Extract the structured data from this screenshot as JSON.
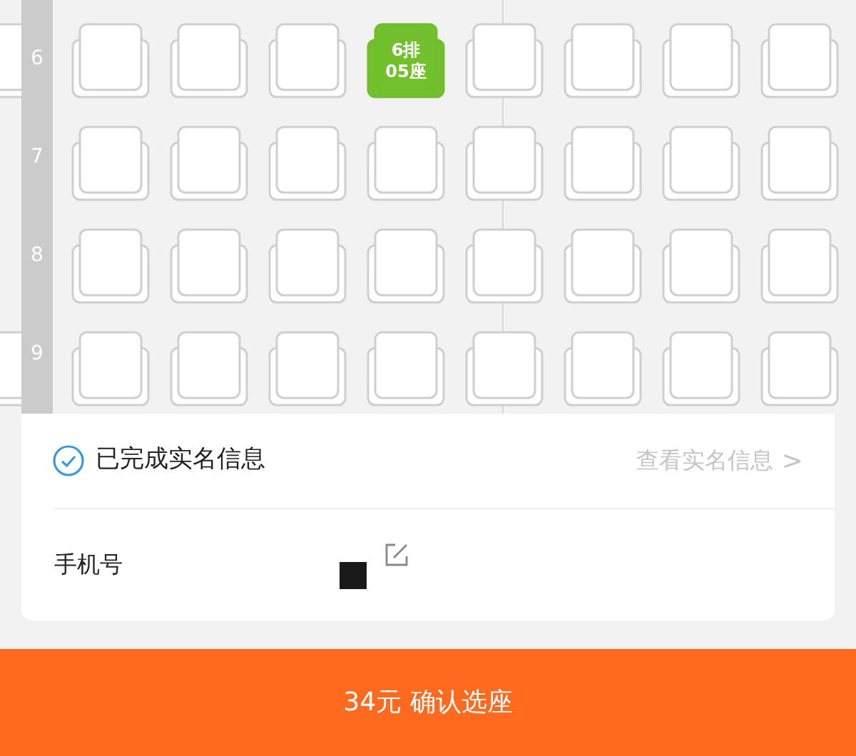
{
  "seat_map": {
    "rows": [
      {
        "label": "6",
        "edge_seat": true,
        "seats": [
          {
            "selected": false
          },
          {
            "selected": false
          },
          {
            "selected": false
          },
          {
            "selected": true,
            "lines": [
              "6排",
              "05座"
            ]
          },
          {
            "selected": false
          },
          {
            "selected": false
          },
          {
            "selected": false
          },
          {
            "selected": false
          }
        ]
      },
      {
        "label": "7",
        "edge_seat": false,
        "seats": [
          {
            "selected": false
          },
          {
            "selected": false
          },
          {
            "selected": false
          },
          {
            "selected": false
          },
          {
            "selected": false
          },
          {
            "selected": false
          },
          {
            "selected": false
          },
          {
            "selected": false
          }
        ]
      },
      {
        "label": "8",
        "edge_seat": false,
        "seats": [
          {
            "selected": false
          },
          {
            "selected": false
          },
          {
            "selected": false
          },
          {
            "selected": false
          },
          {
            "selected": false
          },
          {
            "selected": false
          },
          {
            "selected": false
          },
          {
            "selected": false
          }
        ]
      },
      {
        "label": "9",
        "edge_seat": true,
        "seats": [
          {
            "selected": false
          },
          {
            "selected": false
          },
          {
            "selected": false
          },
          {
            "selected": false
          },
          {
            "selected": false
          },
          {
            "selected": false
          },
          {
            "selected": false
          },
          {
            "selected": false
          }
        ]
      }
    ]
  },
  "real_name": {
    "verified": true,
    "status": "已完成实名信息",
    "link": "查看实名信息",
    "arrow": ">"
  },
  "phone": {
    "label": "手机号",
    "redacted": true
  },
  "confirm_button": {
    "label": "34元 确认选座"
  }
}
